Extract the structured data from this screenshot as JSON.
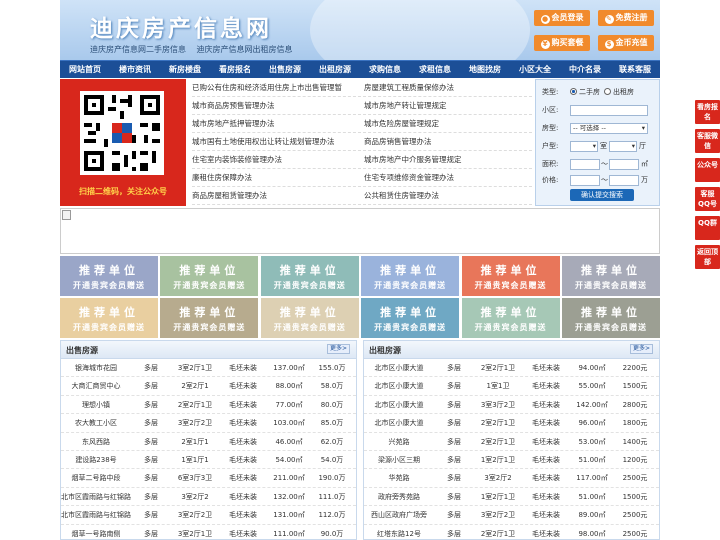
{
  "header": {
    "title": "迪庆房产信息网",
    "subtitle_left": "迪庆房产信息网二手房信息",
    "subtitle_right": "迪庆房产信息网出租房信息",
    "buttons": [
      "会员登录",
      "免费注册",
      "购买套餐",
      "金币充值"
    ]
  },
  "nav": [
    "网站首页",
    "楼市资讯",
    "新房楼盘",
    "看房报名",
    "出售房源",
    "出租房源",
    "求购信息",
    "求租信息",
    "地图找房",
    "小区大全",
    "中介名录",
    "联系客服"
  ],
  "qr": {
    "caption": "扫描二维码，关注公众号"
  },
  "links": [
    [
      "已购公有住房和经济适用住房上市出售管理暂",
      "房屋建筑工程质量保修办法"
    ],
    [
      "城市商品房预售管理办法",
      "城市房地产转让管理规定"
    ],
    [
      "城市房地产抵押管理办法",
      "城市危险房屋管理规定"
    ],
    [
      "城市国有土地使用权出让转让规划管理办法",
      "商品房销售管理办法"
    ],
    [
      "住宅室内装饰装修管理办法",
      "城市房地产中介服务管理规定"
    ],
    [
      "廉租住房保障办法",
      "住宅专项维修资金管理办法"
    ],
    [
      "商品房屋租赁管理办法",
      "公共租赁住房管理办法"
    ]
  ],
  "search": {
    "type_label": "类型:",
    "type_options": [
      "二手房",
      "出租房"
    ],
    "community_label": "小区:",
    "community_value": "",
    "house_label": "房型:",
    "house_select": "-- 可选择 --",
    "layout_label": "户型:",
    "room_unit": "室",
    "hall_unit": "厅",
    "area_label": "面积:",
    "area_sep": "～",
    "area_unit": "㎡",
    "price_label": "价格:",
    "price_unit": "万",
    "submit": "确认提交搜索"
  },
  "recommend": {
    "line1": "推荐单位",
    "line2": "开通贵宾会员赠送",
    "colors": [
      "#9aa6c8",
      "#a8c2a0",
      "#8fbcb8",
      "#9ab3dc",
      "#e8765a",
      "#a7aab8",
      "#e9cfa0",
      "#b7ab8e",
      "#ddd0b3",
      "#6fa8c4",
      "#a6c8b6",
      "#9c9f93"
    ]
  },
  "sale": {
    "title": "出售房源",
    "more": "更多>",
    "rows": [
      [
        "银海城市花园",
        "多层",
        "3室2厅1卫",
        "毛坯未装",
        "137.00㎡",
        "155.0万"
      ],
      [
        "大商汇商贸中心",
        "多层",
        "2室2厅1",
        "毛坯未装",
        "88.00㎡",
        "58.0万"
      ],
      [
        "理想小镇",
        "多层",
        "2室2厅1卫",
        "毛坯未装",
        "77.00㎡",
        "80.0万"
      ],
      [
        "农大教工小区",
        "多层",
        "3室2厅2卫",
        "毛坯未装",
        "103.00㎡",
        "85.0万"
      ],
      [
        "东风西路",
        "多层",
        "2室1厅1",
        "毛坯未装",
        "46.00㎡",
        "62.0万"
      ],
      [
        "建设路238号",
        "多层",
        "1室1厅1",
        "毛坯未装",
        "54.00㎡",
        "54.0万"
      ],
      [
        "烟草二号路中段",
        "多层",
        "6室3厅3卫",
        "毛坯未装",
        "211.00㎡",
        "190.0万"
      ],
      [
        "北市区霞雨路与红锦路",
        "多层",
        "3室2厅2",
        "毛坯未装",
        "132.00㎡",
        "111.0万"
      ],
      [
        "北市区霞雨路与红锦路",
        "多层",
        "3室2厅2卫",
        "毛坯未装",
        "131.00㎡",
        "112.0万"
      ],
      [
        "烟草一号路南侧",
        "多层",
        "3室2厅1卫",
        "毛坯未装",
        "111.00㎡",
        "90.0万"
      ]
    ]
  },
  "rent": {
    "title": "出租房源",
    "more": "更多>",
    "rows": [
      [
        "北市区小康大道",
        "多层",
        "2室2厅1卫",
        "毛坯未装",
        "94.00㎡",
        "2200元"
      ],
      [
        "北市区小康大道",
        "多层",
        "1室1卫",
        "毛坯未装",
        "55.00㎡",
        "1500元"
      ],
      [
        "北市区小康大道",
        "多层",
        "3室3厅2卫",
        "毛坯未装",
        "142.00㎡",
        "2800元"
      ],
      [
        "北市区小康大道",
        "多层",
        "2室2厅1卫",
        "毛坯未装",
        "96.00㎡",
        "1800元"
      ],
      [
        "兴苑路",
        "多层",
        "2室2厅1卫",
        "毛坯未装",
        "53.00㎡",
        "1400元"
      ],
      [
        "梁源小区三期",
        "多层",
        "1室2厅1卫",
        "毛坯未装",
        "51.00㎡",
        "1200元"
      ],
      [
        "华苑路",
        "多层",
        "3室2厅2",
        "毛坯未装",
        "117.00㎡",
        "2500元"
      ],
      [
        "政府旁秀苑路",
        "多层",
        "1室2厅1卫",
        "毛坯未装",
        "51.00㎡",
        "1500元"
      ],
      [
        "西山区政府广场旁",
        "多层",
        "3室2厅2卫",
        "毛坯未装",
        "89.00㎡",
        "2500元"
      ],
      [
        "红塔东路12号",
        "多层",
        "2室2厅1卫",
        "毛坯未装",
        "98.00㎡",
        "2500元"
      ]
    ]
  },
  "float": [
    "看房报名",
    "客服微信",
    "公众号",
    "客服QQ号",
    "QQ群",
    "返回顶部"
  ]
}
